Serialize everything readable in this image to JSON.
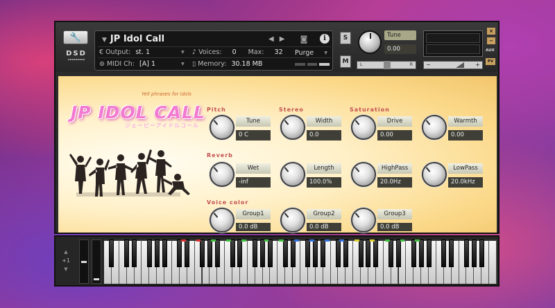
{
  "instrument": {
    "name": "JP Idol Call",
    "output_label": "Output:",
    "output_value": "st. 1",
    "voices_label": "Voices:",
    "voices_value": "0",
    "max_label": "Max:",
    "max_value": "32",
    "purge_label": "Purge",
    "midi_label": "MIDI Ch:",
    "midi_value": "[A]  1",
    "memory_label": "Memory:",
    "memory_value": "30.18 MB",
    "logo_text": "DSD",
    "solo": "S",
    "mute": "M",
    "tune_label": "Tune",
    "tune_value": "0.00",
    "pan_left": "L",
    "pan_right": "R",
    "vol_minus": "−",
    "vol_plus": "+",
    "close": "×",
    "minimize": "−",
    "aux": "AUX",
    "pv": "PV"
  },
  "panel": {
    "title": "JP IDOL CALL",
    "subtitle": "Yell phrases for idols",
    "jp_text": "ジェーピーアイドルコール",
    "sections": {
      "pitch": "Pitch",
      "stereo": "Stereo",
      "saturation": "Saturation",
      "reverb": "Reverb",
      "voice_color": "Voice color"
    },
    "controls": {
      "tune": {
        "label": "Tune",
        "value": "0 C"
      },
      "width": {
        "label": "Width",
        "value": "0.0"
      },
      "drive": {
        "label": "Drive",
        "value": "0.00"
      },
      "warmth": {
        "label": "Warmth",
        "value": "0.00"
      },
      "wet": {
        "label": "Wet",
        "value": "-inf"
      },
      "length": {
        "label": "Length",
        "value": "100.0%"
      },
      "highpass": {
        "label": "HighPass",
        "value": "20.0Hz"
      },
      "lowpass": {
        "label": "LowPass",
        "value": "20.0kHz"
      },
      "group1": {
        "label": "Group1",
        "value": "0.0 dB"
      },
      "group2": {
        "label": "Group2",
        "value": "0.0 dB"
      },
      "group3": {
        "label": "Group3",
        "value": "0.0 dB"
      }
    }
  },
  "keyboard": {
    "octave": "+1",
    "white_key_count": 52,
    "led_colors": [
      "#e03030",
      "#40c040",
      "#3070e0",
      "#e0d030"
    ]
  }
}
